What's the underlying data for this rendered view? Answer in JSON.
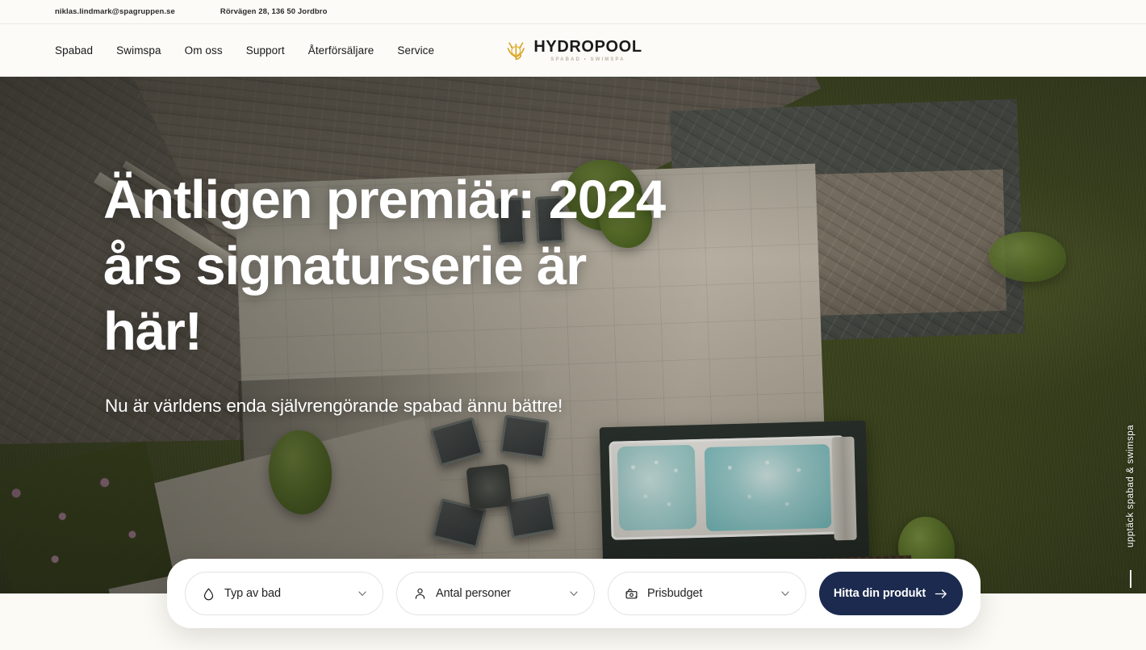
{
  "topbar": {
    "email": "niklas.lindmark@spagruppen.se",
    "address": "Rörvägen 28, 136 50 Jordbro"
  },
  "nav": {
    "items": [
      {
        "label": "Spabad"
      },
      {
        "label": "Swimspa"
      },
      {
        "label": "Om oss"
      },
      {
        "label": "Support"
      },
      {
        "label": "Återförsäljare"
      },
      {
        "label": "Service"
      }
    ]
  },
  "logo": {
    "word": "HYDROPOOL",
    "tagline": "SPABAD • SWIMSPA",
    "mark_color": "#d8a11e"
  },
  "hero": {
    "title_line1": "Äntligen premiär: 2024",
    "title_line2": "års signaturserie är här!",
    "subtitle": "Nu är världens enda självrengörande spabad ännu bättre!",
    "scroll_hint": "upptäck spabad & swimspa"
  },
  "search": {
    "fields": [
      {
        "label": "Typ av bad",
        "icon": "droplet-icon"
      },
      {
        "label": "Antal personer",
        "icon": "person-icon"
      },
      {
        "label": "Prisbudget",
        "icon": "money-icon"
      }
    ],
    "cta_label": "Hitta din produkt",
    "cta_color": "#1b2a4e"
  }
}
